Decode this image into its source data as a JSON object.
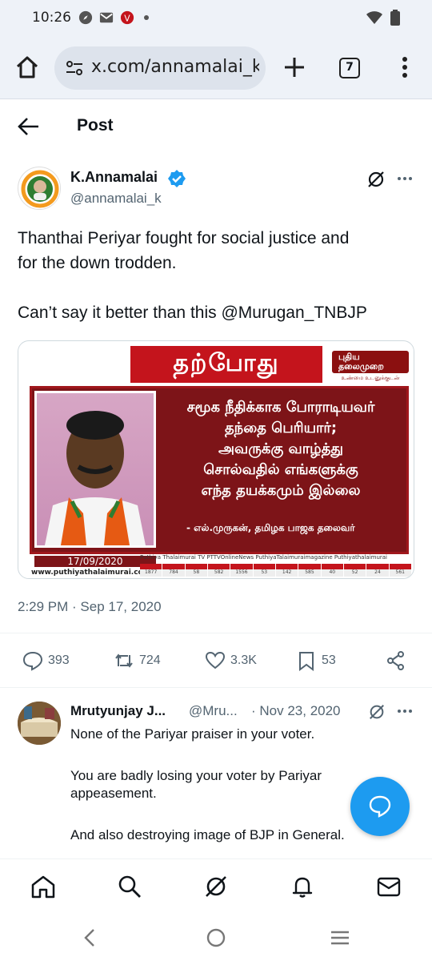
{
  "status_bar": {
    "time": "10:26",
    "icons": [
      "compass-icon",
      "mail-icon",
      "app-icon",
      "dot",
      "wifi-icon",
      "battery-icon"
    ]
  },
  "browser": {
    "url": "x.com/annamalai_k/s",
    "tab_count": "7"
  },
  "header": {
    "title": "Post"
  },
  "post": {
    "author_name": "K.Annamalai",
    "author_handle": "@annamalai_k",
    "text_line1": "Thanthai Periyar fought for social justice and",
    "text_line2": "for the down trodden.",
    "text_line3": "Can’t say it better than this @Murugan_TNBJP",
    "timestamp": "2:29 PM · Sep 17, 2020",
    "media": {
      "banner": "தற்போது",
      "logo": "புதிய தலைமுறை",
      "logo_sub": "உண்மை உடனுக்குடன்",
      "quote_lines": [
        "சமூக நீதிக்காக போராடியவர்",
        "தந்தை பெரியார்;",
        "அவருக்கு வாழ்த்து",
        "சொல்வதில் எங்களுக்கு",
        "எந்த தயக்கமும் இல்லை"
      ],
      "attribution": "- எல்.முருகன், தமிழக பாஜக தலைவர்",
      "date": "17/09/2020",
      "website": "www.puthiyathalaimurai.com",
      "social": "Puthiya Thalaimurai TV   PTTVOnlineNews   PuthiyaTalaimuraimagazine   Puthiyathalaimurai",
      "channels": [
        "1877",
        "784",
        "58",
        "582",
        "1556",
        "53",
        "142",
        "585",
        "40",
        "52",
        "24",
        "561"
      ]
    },
    "stats": {
      "replies": "393",
      "reposts": "724",
      "likes": "3.3K",
      "bookmarks": "53"
    }
  },
  "reply": {
    "name": "Mrutyunjay J...",
    "handle": "@Mru...",
    "date": "· Nov 23, 2020",
    "line1": "None of the Pariyar praiser in your voter.",
    "line2": "You are badly losing your voter by Pariyar",
    "line3": "appeasement.",
    "line4": "And also destroying image of BJP in General."
  },
  "colors": {
    "accent": "#1d9bf0",
    "banner_red": "#c4141c",
    "panel_maroon": "#7d1418",
    "muted": "#536471"
  }
}
